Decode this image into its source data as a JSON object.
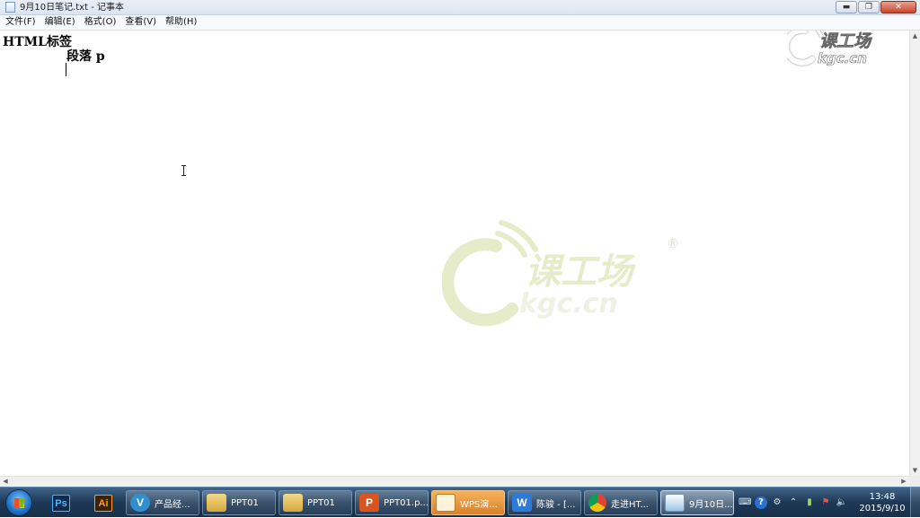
{
  "window": {
    "title": "9月10日笔记.txt - 记事本",
    "minimize_glyph": "▬",
    "maximize_glyph": "❐",
    "close_glyph": "✕"
  },
  "menu": {
    "items": [
      "文件(F)",
      "编辑(E)",
      "格式(O)",
      "查看(V)",
      "帮助(H)"
    ]
  },
  "editor": {
    "lines": [
      "HTML标签",
      "段落 p",
      ""
    ]
  },
  "watermark": {
    "brand": "课工场",
    "domain": "kgc.cn",
    "registered": "®",
    "color_big": "#e6ecc9",
    "color_small": "#ffffff"
  },
  "scrollbar": {
    "up": "▲",
    "down": "▼",
    "left": "◀",
    "right": "▶"
  },
  "taskbar": {
    "pinned": [
      {
        "name": "photoshop-icon",
        "text": "Ps",
        "bg": "#0f2a4a",
        "fg": "#4fb2ff"
      },
      {
        "name": "illustrator-icon",
        "text": "Ai",
        "bg": "#3a2205",
        "fg": "#ff9a1d"
      }
    ],
    "tasks": [
      {
        "icon": "V",
        "label": "产品经...",
        "icon_bg": "#2f8fd0"
      },
      {
        "icon": "",
        "label": "PPT01",
        "icon_bg": "#e8c36b"
      },
      {
        "icon": "",
        "label": "PPT01",
        "icon_bg": "#e8c36b"
      },
      {
        "icon": "P",
        "label": "PPT01.p...",
        "icon_bg": "#d9541f"
      },
      {
        "icon": "",
        "label": "WPS演...",
        "icon_bg": "#f0a640"
      },
      {
        "icon": "W",
        "label": "陈骏 - [...",
        "icon_bg": "#2d7bd6"
      },
      {
        "icon": "",
        "label": "走进HT...",
        "icon_bg": "#ffffff"
      },
      {
        "icon": "",
        "label": "9月10日...",
        "icon_bg": "#bcd6ee"
      }
    ],
    "clock_time": "13:48",
    "clock_date": "2015/9/10"
  }
}
